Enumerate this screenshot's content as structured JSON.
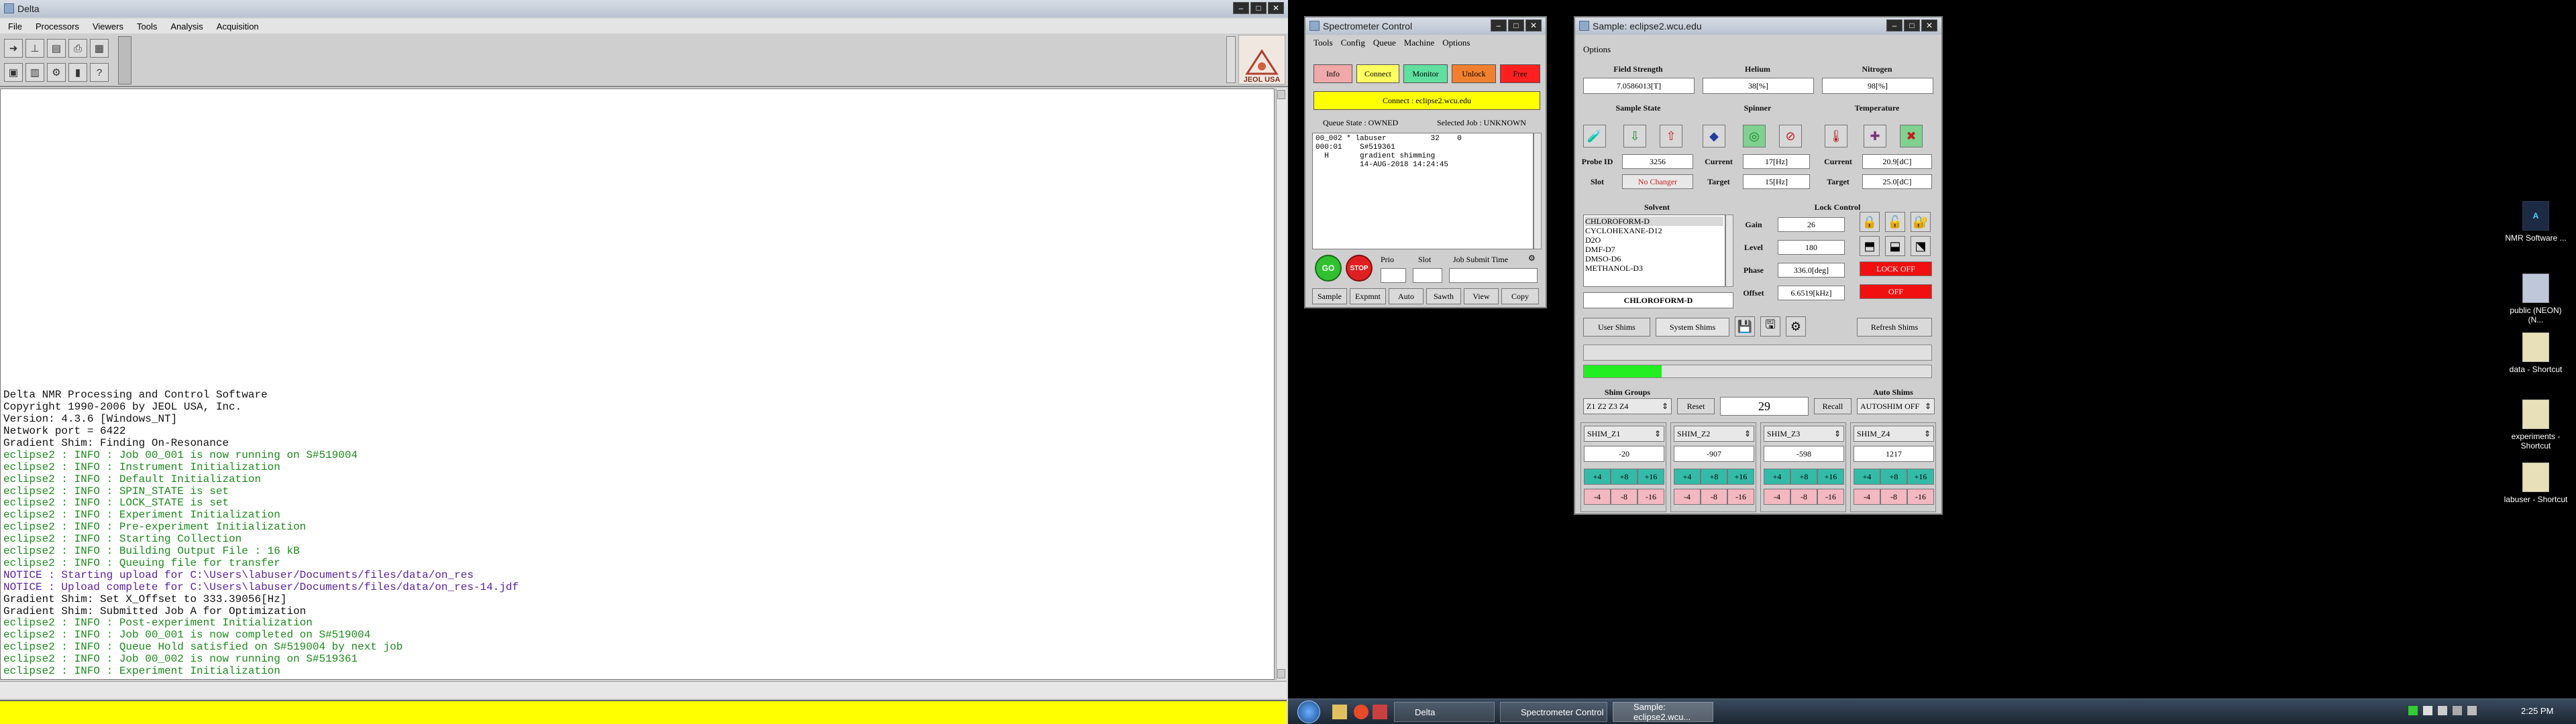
{
  "delta": {
    "title": "Delta",
    "menu": [
      "File",
      "Processors",
      "Viewers",
      "Tools",
      "Analysis",
      "Acquisition"
    ],
    "logo_text": "JEOL USA",
    "console_lines": [
      {
        "text": "Delta NMR Processing and Control Software",
        "color": "black"
      },
      {
        "text": "Copyright 1990-2006 by JEOL USA, Inc.",
        "color": "black"
      },
      {
        "text": "Version: 4.3.6 [Windows_NT]",
        "color": "black"
      },
      {
        "text": "Network port = 6422",
        "color": "black"
      },
      {
        "text": "Gradient Shim: Finding On-Resonance",
        "color": "black"
      },
      {
        "text": "eclipse2 : INFO : Job 00_001 is now running on S#519004",
        "color": "green"
      },
      {
        "text": "eclipse2 : INFO : Instrument Initialization",
        "color": "green"
      },
      {
        "text": "eclipse2 : INFO : Default Initialization",
        "color": "green"
      },
      {
        "text": "eclipse2 : INFO : SPIN_STATE is set",
        "color": "green"
      },
      {
        "text": "eclipse2 : INFO : LOCK_STATE is set",
        "color": "green"
      },
      {
        "text": "eclipse2 : INFO : Experiment Initialization",
        "color": "green"
      },
      {
        "text": "eclipse2 : INFO : Pre-experiment Initialization",
        "color": "green"
      },
      {
        "text": "eclipse2 : INFO : Starting Collection",
        "color": "green"
      },
      {
        "text": "eclipse2 : INFO : Building Output File : 16 kB",
        "color": "green"
      },
      {
        "text": "eclipse2 : INFO : Queuing file for transfer",
        "color": "green"
      },
      {
        "text": "NOTICE : Starting upload for C:\\Users\\labuser/Documents/files/data/on_res",
        "color": "purple"
      },
      {
        "text": "NOTICE : Upload complete for C:\\Users\\labuser/Documents/files/data/on_res-14.jdf",
        "color": "purple"
      },
      {
        "text": "Gradient Shim: Set X_Offset to 333.39056[Hz]",
        "color": "black"
      },
      {
        "text": "Gradient Shim: Submitted Job A for Optimization",
        "color": "black"
      },
      {
        "text": "eclipse2 : INFO : Post-experiment Initialization",
        "color": "green"
      },
      {
        "text": "eclipse2 : INFO : Job 00_001 is now completed on S#519004",
        "color": "green"
      },
      {
        "text": "eclipse2 : INFO : Queue Hold satisfied on S#519004 by next job",
        "color": "green"
      },
      {
        "text": "eclipse2 : INFO : Job 00_002 is now running on S#519361",
        "color": "green"
      },
      {
        "text": "eclipse2 : INFO : Experiment Initialization",
        "color": "green"
      }
    ]
  },
  "spectrometer": {
    "title": "Spectrometer Control",
    "menu": [
      "Tools",
      "Config",
      "Queue",
      "Machine",
      "Options"
    ],
    "buttons": {
      "info": "Info",
      "connect": "Connect",
      "monitor": "Monitor",
      "unlock": "Unlock",
      "free": "Free"
    },
    "connect_status": "Connect : eclipse2.wcu.edu",
    "queue_state": "Queue State : OWNED",
    "selected_job": "Selected Job : UNKNOWN",
    "queue_text": "00_002 * labuser          32    0\n000:01    S#519361\n  H       gradient shimming\n          14-AUG-2018 14:24:45",
    "go": "GO",
    "stop": "STOP",
    "col_prio": "Prio",
    "col_slot": "Slot",
    "col_submit": "Job Submit Time",
    "bottom_buttons": [
      "Sample",
      "Expmnt",
      "Auto",
      "Sawth",
      "View",
      "Copy"
    ]
  },
  "sample": {
    "title": "Sample: eclipse2.wcu.edu",
    "options_menu": "Options",
    "field_strength_label": "Field Strength",
    "helium_label": "Helium",
    "nitrogen_label": "Nitrogen",
    "field_strength": "7.0586013[T]",
    "helium": "38[%]",
    "nitrogen": "98[%]",
    "sample_state_label": "Sample State",
    "spinner_label": "Spinner",
    "temperature_label": "Temperature",
    "probe_id_label": "Probe ID",
    "probe_id": "3256",
    "slot_label": "Slot",
    "slot_value": "No Changer",
    "current_label": "Current",
    "spinner_current": "17[Hz]",
    "target_label": "Target",
    "spinner_target": "15[Hz]",
    "temp_current_label": "Current",
    "temp_current": "20.9[dC]",
    "temp_target_label": "Target",
    "temp_target": "25.0[dC]",
    "solvent_label": "Solvent",
    "solvents": [
      "CHLOROFORM-D",
      "CYCLOHEXANE-D12",
      "D2O",
      "DMF-D7",
      "DMSO-D6",
      "METHANOL-D3"
    ],
    "solvent_selected": "CHLOROFORM-D",
    "lock_control_label": "Lock Control",
    "gain_label": "Gain",
    "gain": "26",
    "level_label": "Level",
    "level": "180",
    "phase_label": "Phase",
    "phase": "336.0[deg]",
    "offset_label": "Offset",
    "offset": "6.6519[kHz]",
    "lock_off": "LOCK OFF",
    "lock_off2": "OFF",
    "user_shims": "User Shims",
    "system_shims": "System Shims",
    "refresh_shims": "Refresh Shims",
    "shim_groups_label": "Shim Groups",
    "shim_group": "Z1 Z2 Z3 Z4",
    "reset": "Reset",
    "shim_count": "29",
    "recall": "Recall",
    "auto_shims_label": "Auto Shims",
    "auto_shims": "AUTOSHIM OFF",
    "shims": [
      {
        "name": "SHIM_Z1",
        "value": "-20"
      },
      {
        "name": "SHIM_Z2",
        "value": "-907"
      },
      {
        "name": "SHIM_Z3",
        "value": "-598"
      },
      {
        "name": "SHIM_Z4",
        "value": "1217"
      }
    ],
    "step_up": [
      "+4",
      "+8",
      "+16"
    ],
    "step_down": [
      "-4",
      "-8",
      "-16"
    ]
  },
  "desktop": {
    "icons": [
      {
        "label": "NMR Software ...",
        "icon": "nmr-icon"
      },
      {
        "label": "public (NEON) (N...",
        "icon": "network-drive-icon"
      },
      {
        "label": "data - Shortcut",
        "icon": "folder-icon"
      },
      {
        "label": "experiments - Shortcut",
        "icon": "folder-icon"
      },
      {
        "label": "labuser - Shortcut",
        "icon": "folder-icon"
      }
    ]
  },
  "taskbar": {
    "tasks": [
      "Delta",
      "Spectrometer Control",
      "Sample: eclipse2.wcu..."
    ],
    "clock": "2:25 PM"
  }
}
